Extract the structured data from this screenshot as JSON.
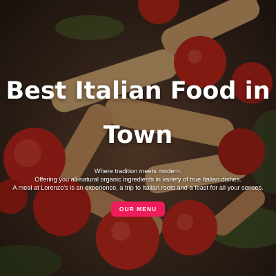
{
  "hero": {
    "title": "Best Italian Food in Town",
    "tagline_lines": [
      "Where tradition meets modern.",
      "Offering you all-natural organic ingredients in variety of true Italian dishes.",
      "A meal at Lorenzo's is an experience, a trip to Italian roots and a feast for all your senses."
    ],
    "menu_button_label": "OUR MENU"
  },
  "colors": {
    "accent": "#ef1c5b",
    "text": "#ffffff"
  }
}
